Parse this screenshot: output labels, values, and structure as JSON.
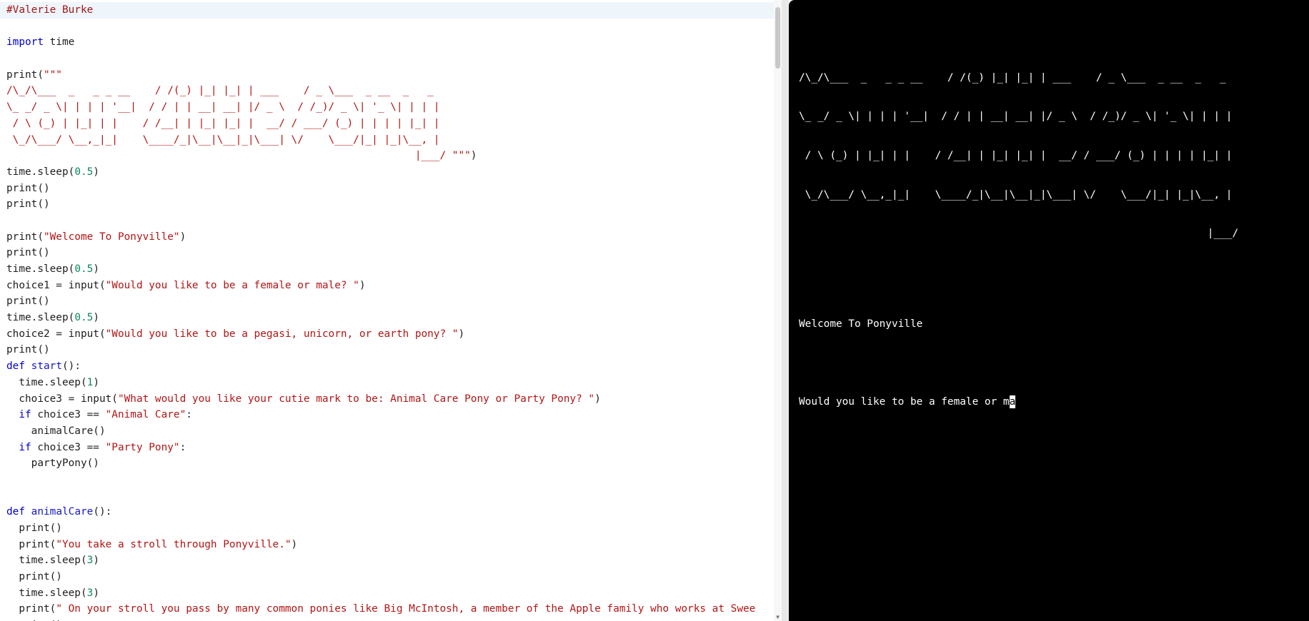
{
  "editor": {
    "lines": [
      [
        {
          "t": "#Valerie Burke",
          "c": "cm"
        }
      ],
      [],
      [
        {
          "t": "import",
          "c": "kw"
        },
        {
          "t": " time"
        }
      ],
      [],
      [
        {
          "t": "print("
        },
        {
          "t": "\"\"\"",
          "c": "str"
        }
      ],
      [
        {
          "t": "/\\_/\\___  _   _ _ __    / /(_) |_| |_| | ___    / _ \\___  _ __  _   _",
          "c": "str"
        }
      ],
      [
        {
          "t": "\\_ _/ _ \\| | | | '__|  / / | | __| __| |/ _ \\  / /_)/ _ \\| '_ \\| | | |",
          "c": "str"
        }
      ],
      [
        {
          "t": " / \\ (_) | |_| | |    / /__| | |_| |_| |  __/ / ___/ (_) | | | | |_| |",
          "c": "str"
        }
      ],
      [
        {
          "t": " \\_/\\___/ \\__,_|_|    \\____/_|\\__|\\__|_|\\___| \\/    \\___/|_| |_|\\__, |",
          "c": "str"
        }
      ],
      [
        {
          "t": "                                                                  |___/ \"\"\"",
          "c": "str"
        },
        {
          "t": ")"
        }
      ],
      [
        {
          "t": "time.sleep("
        },
        {
          "t": "0.5",
          "c": "num"
        },
        {
          "t": ")"
        }
      ],
      [
        {
          "t": "print()"
        }
      ],
      [
        {
          "t": "print()"
        }
      ],
      [],
      [
        {
          "t": "print("
        },
        {
          "t": "\"Welcome To Ponyville\"",
          "c": "str"
        },
        {
          "t": ")"
        }
      ],
      [
        {
          "t": "print()"
        }
      ],
      [
        {
          "t": "time.sleep("
        },
        {
          "t": "0.5",
          "c": "num"
        },
        {
          "t": ")"
        }
      ],
      [
        {
          "t": "choice1 = input("
        },
        {
          "t": "\"Would you like to be a female or male? \"",
          "c": "str"
        },
        {
          "t": ")"
        }
      ],
      [
        {
          "t": "print()"
        }
      ],
      [
        {
          "t": "time.sleep("
        },
        {
          "t": "0.5",
          "c": "num"
        },
        {
          "t": ")"
        }
      ],
      [
        {
          "t": "choice2 = input("
        },
        {
          "t": "\"Would you like to be a pegasi, unicorn, or earth pony? \"",
          "c": "str"
        },
        {
          "t": ")"
        }
      ],
      [
        {
          "t": "print()"
        }
      ],
      [
        {
          "t": "def",
          "c": "kw"
        },
        {
          "t": " "
        },
        {
          "t": "start",
          "c": "fn"
        },
        {
          "t": "():"
        }
      ],
      [
        {
          "t": "  time.sleep("
        },
        {
          "t": "1",
          "c": "num"
        },
        {
          "t": ")"
        }
      ],
      [
        {
          "t": "  choice3 = input("
        },
        {
          "t": "\"What would you like your cutie mark to be: Animal Care Pony or Party Pony? \"",
          "c": "str"
        },
        {
          "t": ")"
        }
      ],
      [
        {
          "t": "  "
        },
        {
          "t": "if",
          "c": "kw"
        },
        {
          "t": " choice3 == "
        },
        {
          "t": "\"Animal Care\"",
          "c": "str"
        },
        {
          "t": ":"
        }
      ],
      [
        {
          "t": "    animalCare()"
        }
      ],
      [
        {
          "t": "  "
        },
        {
          "t": "if",
          "c": "kw"
        },
        {
          "t": " choice3 == "
        },
        {
          "t": "\"Party Pony\"",
          "c": "str"
        },
        {
          "t": ":"
        }
      ],
      [
        {
          "t": "    partyPony()"
        }
      ],
      [],
      [],
      [
        {
          "t": "def",
          "c": "kw"
        },
        {
          "t": " "
        },
        {
          "t": "animalCare",
          "c": "fn"
        },
        {
          "t": "():"
        }
      ],
      [
        {
          "t": "  print()"
        }
      ],
      [
        {
          "t": "  print("
        },
        {
          "t": "\"You take a stroll through Ponyville.\"",
          "c": "str"
        },
        {
          "t": ")"
        }
      ],
      [
        {
          "t": "  time.sleep("
        },
        {
          "t": "3",
          "c": "num"
        },
        {
          "t": ")"
        }
      ],
      [
        {
          "t": "  print()"
        }
      ],
      [
        {
          "t": "  time.sleep("
        },
        {
          "t": "3",
          "c": "num"
        },
        {
          "t": ")"
        }
      ],
      [
        {
          "t": "  print("
        },
        {
          "t": "\" On your stroll you pass by many common ponies like Big McIntosh, a member of the Apple family who works at Swee",
          "c": "str"
        }
      ],
      [
        {
          "t": "  print()"
        }
      ]
    ]
  },
  "console": {
    "art": [
      "/\\_/\\___  _   _ _ __    / /(_) |_| |_| | ___    / _ \\___  _ __  _   _",
      "\\_ _/ _ \\| | | | '__|  / / | | __| __| |/ _ \\  / /_)/ _ \\| '_ \\| | | |",
      " / \\ (_) | |_| | |    / /__| | |_| |_| |  __/ / ___/ (_) | | | | |_| |",
      " \\_/\\___/ \\__,_|_|    \\____/_|\\__|\\__|_|\\___| \\/    \\___/|_| |_|\\__, |",
      "                                                                  |___/"
    ],
    "welcome": "Welcome To Ponyville",
    "prompt": "Would you like to be a female or ",
    "typed": "m",
    "cursor_char": "a"
  },
  "colors": {
    "console_bg": "#000000",
    "keyword": "#0000cc",
    "string": "#b31515",
    "number": "#09885a"
  }
}
